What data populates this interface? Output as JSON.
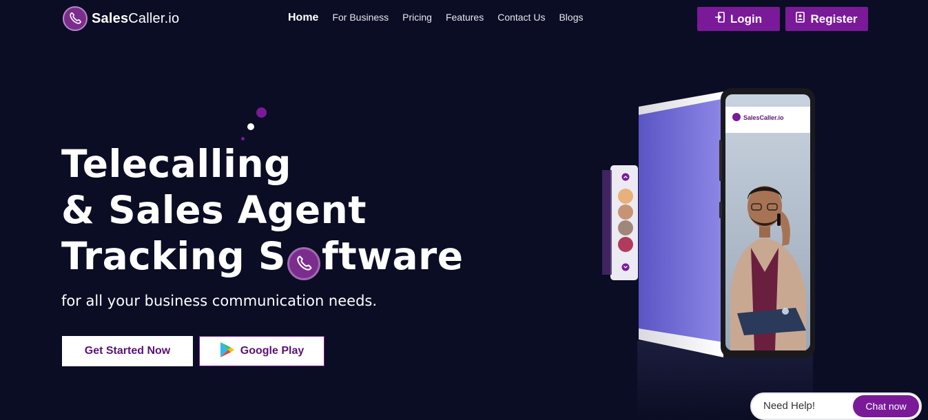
{
  "brand": {
    "name_bold": "Sales",
    "name_rest": "Caller.io",
    "accent": "#7a1a99",
    "background": "#0b0d24"
  },
  "nav": {
    "items": [
      {
        "label": "Home"
      },
      {
        "label": "For Business"
      },
      {
        "label": "Pricing"
      },
      {
        "label": "Features"
      },
      {
        "label": "Contact Us"
      },
      {
        "label": "Blogs"
      }
    ]
  },
  "header": {
    "login_label": "Login",
    "login_icon": "login-icon",
    "register_label": "Register",
    "register_icon": "register-icon"
  },
  "hero": {
    "title_line1": "Telecalling",
    "title_line2": "& Sales Agent",
    "title_line3_start": "Tracking S",
    "title_line3_end": "ftware",
    "subtitle": "for all your business communication needs.",
    "cta_primary": "Get Started Now",
    "cta_secondary": "Google Play"
  },
  "phone": {
    "brand_label": "SalesCaller.io"
  },
  "chat": {
    "prompt": "Need Help!",
    "button": "Chat now"
  }
}
